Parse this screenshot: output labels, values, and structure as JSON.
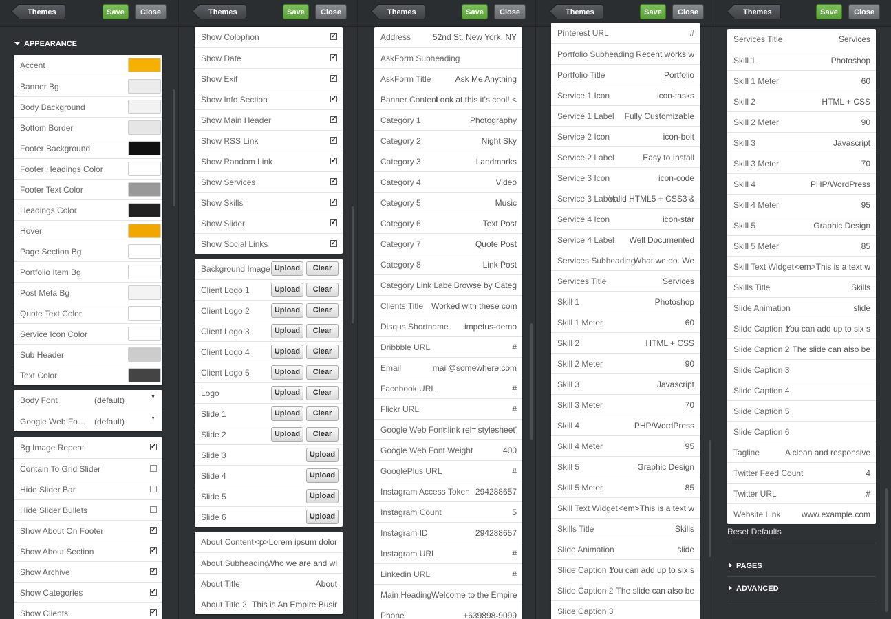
{
  "toolbar": {
    "themes_label": "Themes",
    "save_label": "Save",
    "close_label": "Close"
  },
  "colors": {
    "accent": "#f5a700",
    "save_green": "#6ab04c"
  },
  "panel1": {
    "section_title": "APPEARANCE",
    "colors": [
      {
        "label": "Accent",
        "color": "#f5b000"
      },
      {
        "label": "Banner Bg",
        "color": "#ececec"
      },
      {
        "label": "Body Background",
        "color": "#f2f2f2"
      },
      {
        "label": "Bottom Border",
        "color": "#e6e6e6"
      },
      {
        "label": "Footer Background",
        "color": "#111111"
      },
      {
        "label": "Footer Headings Color",
        "color": "#ffffff"
      },
      {
        "label": "Footer Text Color",
        "color": "#999999"
      },
      {
        "label": "Headings Color",
        "color": "#222222"
      },
      {
        "label": "Hover",
        "color": "#f0a800"
      },
      {
        "label": "Page Section Bg",
        "color": "#ffffff"
      },
      {
        "label": "Portfolio Item Bg",
        "color": "#ffffff"
      },
      {
        "label": "Post Meta Bg",
        "color": "#f3f3f3"
      },
      {
        "label": "Quote Text Color",
        "color": "#ffffff"
      },
      {
        "label": "Service Icon Color",
        "color": "#ffffff"
      },
      {
        "label": "Sub Header",
        "color": "#cccccc"
      },
      {
        "label": "Text Color",
        "color": "#444444"
      }
    ],
    "fonts": [
      {
        "label": "Body Font",
        "value": "(default)"
      },
      {
        "label": "Google Web Fo…",
        "value": "(default)"
      }
    ],
    "checks": [
      {
        "label": "Bg Image Repeat",
        "checked": true
      },
      {
        "label": "Contain To Grid Slider",
        "checked": false
      },
      {
        "label": "Hide Slider Bar",
        "checked": false
      },
      {
        "label": "Hide Slider Bullets",
        "checked": false
      },
      {
        "label": "Show About On Footer",
        "checked": true
      },
      {
        "label": "Show About Section",
        "checked": true
      },
      {
        "label": "Show Archive",
        "checked": true
      },
      {
        "label": "Show Categories",
        "checked": true
      },
      {
        "label": "Show Clients",
        "checked": true
      }
    ]
  },
  "panel2": {
    "checks": [
      {
        "label": "Show Colophon",
        "checked": true
      },
      {
        "label": "Show Date",
        "checked": true
      },
      {
        "label": "Show Exif",
        "checked": true
      },
      {
        "label": "Show Info Section",
        "checked": true
      },
      {
        "label": "Show Main Header",
        "checked": true
      },
      {
        "label": "Show RSS Link",
        "checked": true
      },
      {
        "label": "Show Random Link",
        "checked": true
      },
      {
        "label": "Show Services",
        "checked": true
      },
      {
        "label": "Show Skills",
        "checked": true
      },
      {
        "label": "Show Slider",
        "checked": true
      },
      {
        "label": "Show Social Links",
        "checked": true
      }
    ],
    "upload_label": "Upload",
    "clear_label": "Clear",
    "uploads": [
      {
        "label": "Background Image",
        "clear": true
      },
      {
        "label": "Client Logo 1",
        "clear": true
      },
      {
        "label": "Client Logo 2",
        "clear": true
      },
      {
        "label": "Client Logo 3",
        "clear": true
      },
      {
        "label": "Client Logo 4",
        "clear": true
      },
      {
        "label": "Client Logo 5",
        "clear": true
      },
      {
        "label": "Logo",
        "clear": true
      },
      {
        "label": "Slide 1",
        "clear": true
      },
      {
        "label": "Slide 2",
        "clear": true
      },
      {
        "label": "Slide 3",
        "clear": false
      },
      {
        "label": "Slide 4",
        "clear": false
      },
      {
        "label": "Slide 5",
        "clear": false
      },
      {
        "label": "Slide 6",
        "clear": false
      }
    ],
    "texts": [
      {
        "label": "About Content",
        "value": "<p>Lorem ipsum dolor"
      },
      {
        "label": "About Subheading",
        "value": "Who we are and wl"
      },
      {
        "label": "About Title",
        "value": "About"
      },
      {
        "label": "About Title 2",
        "value": "This is An Empire Busin"
      }
    ]
  },
  "panel3": {
    "texts": [
      {
        "label": "Address",
        "value": "52nd St. New York, NY"
      },
      {
        "label": "AskForm Subheading",
        "value": ""
      },
      {
        "label": "AskForm Title",
        "value": "Ask Me Anything"
      },
      {
        "label": "Banner Content",
        "value": "Look at this it's cool! <"
      },
      {
        "label": "Category 1",
        "value": "Photography"
      },
      {
        "label": "Category 2",
        "value": "Night Sky"
      },
      {
        "label": "Category 3",
        "value": "Landmarks"
      },
      {
        "label": "Category 4",
        "value": "Video"
      },
      {
        "label": "Category 5",
        "value": "Music"
      },
      {
        "label": "Category 6",
        "value": "Text Post"
      },
      {
        "label": "Category 7",
        "value": "Quote Post"
      },
      {
        "label": "Category 8",
        "value": "Link Post"
      },
      {
        "label": "Category Link Label",
        "value": "Browse by Categ"
      },
      {
        "label": "Clients Title",
        "value": "Worked with these comp"
      },
      {
        "label": "Disqus Shortname",
        "value": "impetus-demo"
      },
      {
        "label": "Dribbble URL",
        "value": "#"
      },
      {
        "label": "Email",
        "value": "mail@somewhere.com"
      },
      {
        "label": "Facebook URL",
        "value": "#"
      },
      {
        "label": "Flickr URL",
        "value": "#"
      },
      {
        "label": "Google Web Font",
        "value": "<link rel='stylesheet'"
      },
      {
        "label": "Google Web Font Weight",
        "value": "400"
      },
      {
        "label": "GooglePlus URL",
        "value": "#"
      },
      {
        "label": "Instagram Access Token",
        "value": "294288657"
      },
      {
        "label": "Instagram Count",
        "value": "5"
      },
      {
        "label": "Instagram ID",
        "value": "294288657"
      },
      {
        "label": "Instagram URL",
        "value": "#"
      },
      {
        "label": "Linkedin URL",
        "value": "#"
      },
      {
        "label": "Main Heading",
        "value": "Welcome to the Empire"
      },
      {
        "label": "Phone",
        "value": "+639898-9099"
      }
    ]
  },
  "panel4": {
    "texts": [
      {
        "label": "Pinterest URL",
        "value": "#"
      },
      {
        "label": "Portfolio Subheading",
        "value": "Recent works w"
      },
      {
        "label": "Portfolio Title",
        "value": "Portfolio"
      },
      {
        "label": "Service 1 Icon",
        "value": "icon-tasks"
      },
      {
        "label": "Service 1 Label",
        "value": "Fully Customizable"
      },
      {
        "label": "Service 2 Icon",
        "value": "icon-bolt"
      },
      {
        "label": "Service 2 Label",
        "value": "Easy to Install"
      },
      {
        "label": "Service 3 Icon",
        "value": "icon-code"
      },
      {
        "label": "Service 3 Label",
        "value": "Valid HTML5 + CSS3 &"
      },
      {
        "label": "Service 4 Icon",
        "value": "icon-star"
      },
      {
        "label": "Service 4 Label",
        "value": "Well Documented"
      },
      {
        "label": "Services Subheading",
        "value": "What we do. We"
      },
      {
        "label": "Services Title",
        "value": "Services"
      },
      {
        "label": "Skill 1",
        "value": "Photoshop"
      },
      {
        "label": "Skill 1 Meter",
        "value": "60"
      },
      {
        "label": "Skill 2",
        "value": "HTML + CSS"
      },
      {
        "label": "Skill 2 Meter",
        "value": "90"
      },
      {
        "label": "Skill 3",
        "value": "Javascript"
      },
      {
        "label": "Skill 3 Meter",
        "value": "70"
      },
      {
        "label": "Skill 4",
        "value": "PHP/WordPress"
      },
      {
        "label": "Skill 4 Meter",
        "value": "95"
      },
      {
        "label": "Skill 5",
        "value": "Graphic Design"
      },
      {
        "label": "Skill 5 Meter",
        "value": "85"
      },
      {
        "label": "Skill Text Widget",
        "value": "<em>This is a text w"
      },
      {
        "label": "Skills Title",
        "value": "Skills"
      },
      {
        "label": "Slide Animation",
        "value": "slide"
      },
      {
        "label": "Slide Caption 1",
        "value": "You can add up to six s"
      },
      {
        "label": "Slide Caption 2",
        "value": "The slide can also be"
      },
      {
        "label": "Slide Caption 3",
        "value": ""
      }
    ]
  },
  "panel5": {
    "texts": [
      {
        "label": "Services Title",
        "value": "Services"
      },
      {
        "label": "Skill 1",
        "value": "Photoshop"
      },
      {
        "label": "Skill 1 Meter",
        "value": "60"
      },
      {
        "label": "Skill 2",
        "value": "HTML + CSS"
      },
      {
        "label": "Skill 2 Meter",
        "value": "90"
      },
      {
        "label": "Skill 3",
        "value": "Javascript"
      },
      {
        "label": "Skill 3 Meter",
        "value": "70"
      },
      {
        "label": "Skill 4",
        "value": "PHP/WordPress"
      },
      {
        "label": "Skill 4 Meter",
        "value": "95"
      },
      {
        "label": "Skill 5",
        "value": "Graphic Design"
      },
      {
        "label": "Skill 5 Meter",
        "value": "85"
      },
      {
        "label": "Skill Text Widget",
        "value": "<em>This is a text w"
      },
      {
        "label": "Skills Title",
        "value": "Skills"
      },
      {
        "label": "Slide Animation",
        "value": "slide"
      },
      {
        "label": "Slide Caption 1",
        "value": "You can add up to six s"
      },
      {
        "label": "Slide Caption 2",
        "value": "The slide can also be"
      },
      {
        "label": "Slide Caption 3",
        "value": ""
      },
      {
        "label": "Slide Caption 4",
        "value": ""
      },
      {
        "label": "Slide Caption 5",
        "value": ""
      },
      {
        "label": "Slide Caption 6",
        "value": ""
      },
      {
        "label": "Tagline",
        "value": "A clean and responsive <sp"
      },
      {
        "label": "Twitter Feed Count",
        "value": "4"
      },
      {
        "label": "Twitter URL",
        "value": "#"
      },
      {
        "label": "Website Link",
        "value": "www.example.com"
      }
    ],
    "reset_label": "Reset Defaults",
    "pages_label": "PAGES",
    "advanced_label": "ADVANCED"
  }
}
